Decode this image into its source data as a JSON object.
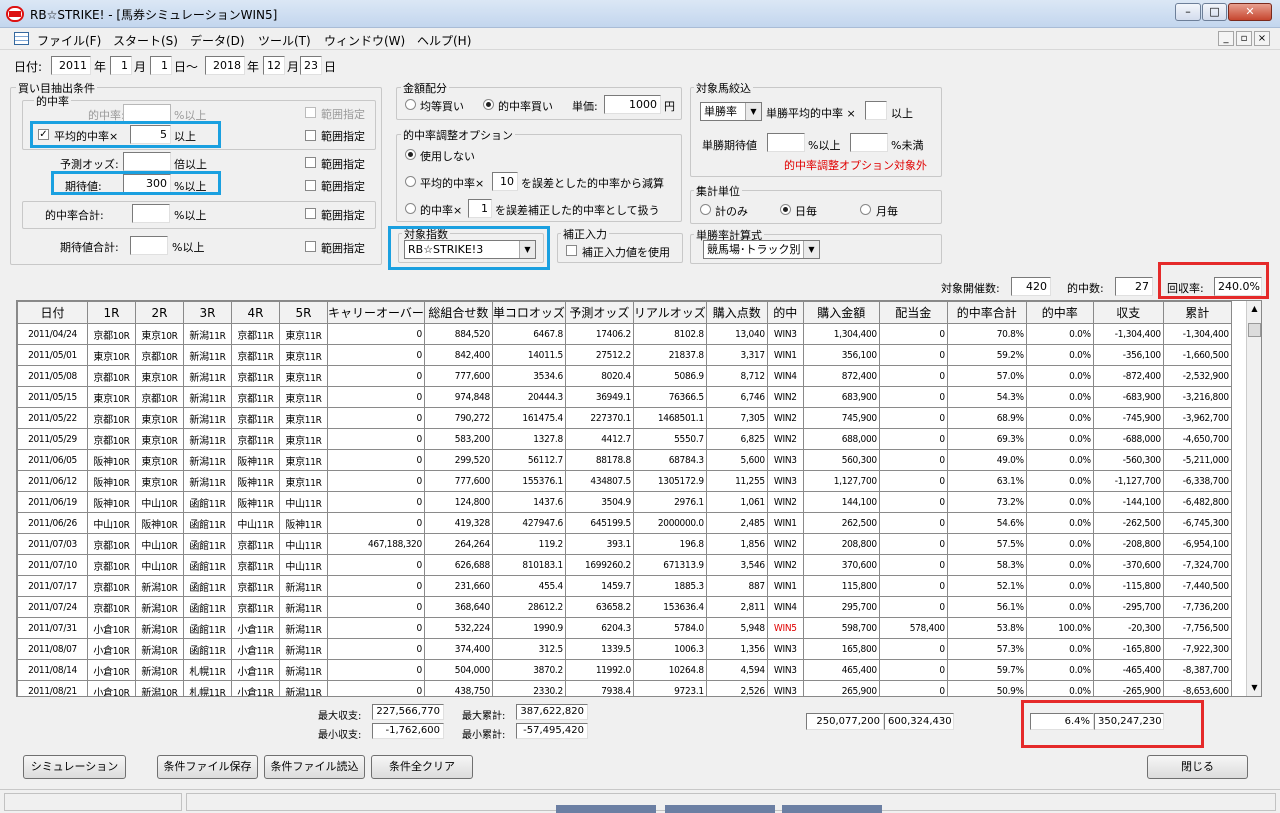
{
  "window": {
    "title": "RB☆STRIKE! - [馬券シミュレーションWIN5]"
  },
  "menu": {
    "items": [
      "ファイル(F)",
      "スタート(S)",
      "データ(D)",
      "ツール(T)",
      "ウィンドウ(W)",
      "ヘルプ(H)"
    ]
  },
  "date": {
    "label": "日付:",
    "start_year": "2011",
    "year_unit": "年",
    "start_month": "1",
    "month_unit": "月",
    "start_day": "1",
    "day_tilde": "日～",
    "end_year": "2018",
    "end_month": "12",
    "end_day": "23",
    "end_day_unit": "日"
  },
  "buy": {
    "group": "買い目抽出条件",
    "sub": "的中率",
    "hit_rate_label": "的中率:",
    "hit_rate_suffix": "%以上",
    "avg_hit_label": "平均的中率×",
    "avg_hit_value": "5",
    "avg_hit_suffix": "以上",
    "pred_odds_label": "予測オッズ:",
    "pred_odds_suffix": "倍以上",
    "ev_label": "期待値:",
    "ev_value": "300",
    "ev_suffix": "%以上",
    "hit_total_label": "的中率合計:",
    "hit_total_suffix": "%以上",
    "ev_total_label": "期待値合計:",
    "ev_total_suffix": "%以上",
    "range_label": "範囲指定"
  },
  "money": {
    "group": "金額配分",
    "equal": "均等買い",
    "hit_buy": "的中率買い",
    "unit_label": "単価:",
    "unit_value": "1000",
    "unit_suffix": "円"
  },
  "adjust": {
    "group": "的中率調整オプション",
    "none": "使用しない",
    "opt1_pre": "平均的中率×",
    "opt1_value": "10",
    "opt1_post": "を誤差とした的中率から減算",
    "opt2_pre": "的中率×",
    "opt2_value": "1",
    "opt2_post": "を誤差補正した的中率として扱う"
  },
  "target_index": {
    "group": "対象指数",
    "value": "RB☆STRIKE!3"
  },
  "correction": {
    "group": "補正入力",
    "label": "補正入力値を使用"
  },
  "horse": {
    "group": "対象馬絞込",
    "sel": "単勝率",
    "avg_label": "単勝平均的中率 ×",
    "avg_suffix": "以上",
    "ev_label": "単勝期待値",
    "ev_mid": "%以上",
    "ev_suffix": "%未満",
    "note": "的中率調整オプション対象外"
  },
  "unit": {
    "group": "集計単位",
    "total": "計のみ",
    "daily": "日毎",
    "monthly": "月毎"
  },
  "calc": {
    "group": "単勝率計算式",
    "value": "競馬場･トラック別"
  },
  "summary": {
    "events_label": "対象開催数:",
    "events_value": "420",
    "hits_label": "的中数:",
    "hits_value": "27",
    "return_label": "回収率:",
    "return_value": "240.0%"
  },
  "table": {
    "headers": [
      "日付",
      "1R",
      "2R",
      "3R",
      "4R",
      "5R",
      "キャリーオーバー",
      "総組合せ数",
      "単コロオッズ",
      "予測オッズ",
      "リアルオッズ",
      "購入点数",
      "的中",
      "購入金額",
      "配当金",
      "的中率合計",
      "的中率",
      "収支",
      "累計"
    ],
    "rows": [
      [
        "2011/04/24",
        "京都10R",
        "東京10R",
        "新潟11R",
        "京都11R",
        "東京11R",
        "0",
        "884,520",
        "6467.8",
        "17406.2",
        "8102.8",
        "13,040",
        "WIN3",
        "1,304,400",
        "0",
        "70.8%",
        "0.0%",
        "-1,304,400",
        "-1,304,400"
      ],
      [
        "2011/05/01",
        "東京10R",
        "京都10R",
        "新潟11R",
        "京都11R",
        "東京11R",
        "0",
        "842,400",
        "14011.5",
        "27512.2",
        "21837.8",
        "3,317",
        "WIN1",
        "356,100",
        "0",
        "59.2%",
        "0.0%",
        "-356,100",
        "-1,660,500"
      ],
      [
        "2011/05/08",
        "京都10R",
        "東京10R",
        "新潟11R",
        "京都11R",
        "東京11R",
        "0",
        "777,600",
        "3534.6",
        "8020.4",
        "5086.9",
        "8,712",
        "WIN4",
        "872,400",
        "0",
        "57.0%",
        "0.0%",
        "-872,400",
        "-2,532,900"
      ],
      [
        "2011/05/15",
        "東京10R",
        "京都10R",
        "新潟11R",
        "京都11R",
        "東京11R",
        "0",
        "974,848",
        "20444.3",
        "36949.1",
        "76366.5",
        "6,746",
        "WIN2",
        "683,900",
        "0",
        "54.3%",
        "0.0%",
        "-683,900",
        "-3,216,800"
      ],
      [
        "2011/05/22",
        "京都10R",
        "東京10R",
        "新潟11R",
        "京都11R",
        "東京11R",
        "0",
        "790,272",
        "161475.4",
        "227370.1",
        "1468501.1",
        "7,305",
        "WIN2",
        "745,900",
        "0",
        "68.9%",
        "0.0%",
        "-745,900",
        "-3,962,700"
      ],
      [
        "2011/05/29",
        "京都10R",
        "東京10R",
        "新潟11R",
        "京都11R",
        "東京11R",
        "0",
        "583,200",
        "1327.8",
        "4412.7",
        "5550.7",
        "6,825",
        "WIN2",
        "688,000",
        "0",
        "69.3%",
        "0.0%",
        "-688,000",
        "-4,650,700"
      ],
      [
        "2011/06/05",
        "阪神10R",
        "東京10R",
        "新潟11R",
        "阪神11R",
        "東京11R",
        "0",
        "299,520",
        "56112.7",
        "88178.8",
        "68784.3",
        "5,600",
        "WIN3",
        "560,300",
        "0",
        "49.0%",
        "0.0%",
        "-560,300",
        "-5,211,000"
      ],
      [
        "2011/06/12",
        "阪神10R",
        "東京10R",
        "新潟11R",
        "阪神11R",
        "東京11R",
        "0",
        "777,600",
        "155376.1",
        "434807.5",
        "1305172.9",
        "11,255",
        "WIN3",
        "1,127,700",
        "0",
        "63.1%",
        "0.0%",
        "-1,127,700",
        "-6,338,700"
      ],
      [
        "2011/06/19",
        "阪神10R",
        "中山10R",
        "函館11R",
        "阪神11R",
        "中山11R",
        "0",
        "124,800",
        "1437.6",
        "3504.9",
        "2976.1",
        "1,061",
        "WIN2",
        "144,100",
        "0",
        "73.2%",
        "0.0%",
        "-144,100",
        "-6,482,800"
      ],
      [
        "2011/06/26",
        "中山10R",
        "阪神10R",
        "函館11R",
        "中山11R",
        "阪神11R",
        "0",
        "419,328",
        "427947.6",
        "645199.5",
        "2000000.0",
        "2,485",
        "WIN1",
        "262,500",
        "0",
        "54.6%",
        "0.0%",
        "-262,500",
        "-6,745,300"
      ],
      [
        "2011/07/03",
        "京都10R",
        "中山10R",
        "函館11R",
        "京都11R",
        "中山11R",
        "467,188,320",
        "264,264",
        "119.2",
        "393.1",
        "196.8",
        "1,856",
        "WIN2",
        "208,800",
        "0",
        "57.5%",
        "0.0%",
        "-208,800",
        "-6,954,100"
      ],
      [
        "2011/07/10",
        "京都10R",
        "中山10R",
        "函館11R",
        "京都11R",
        "中山11R",
        "0",
        "626,688",
        "810183.1",
        "1699260.2",
        "671313.9",
        "3,546",
        "WIN2",
        "370,600",
        "0",
        "58.3%",
        "0.0%",
        "-370,600",
        "-7,324,700"
      ],
      [
        "2011/07/17",
        "京都10R",
        "新潟10R",
        "函館11R",
        "京都11R",
        "新潟11R",
        "0",
        "231,660",
        "455.4",
        "1459.7",
        "1885.3",
        "887",
        "WIN1",
        "115,800",
        "0",
        "52.1%",
        "0.0%",
        "-115,800",
        "-7,440,500"
      ],
      [
        "2011/07/24",
        "京都10R",
        "新潟10R",
        "函館11R",
        "京都11R",
        "新潟11R",
        "0",
        "368,640",
        "28612.2",
        "63658.2",
        "153636.4",
        "2,811",
        "WIN4",
        "295,700",
        "0",
        "56.1%",
        "0.0%",
        "-295,700",
        "-7,736,200"
      ],
      [
        "2011/07/31",
        "小倉10R",
        "新潟10R",
        "函館11R",
        "小倉11R",
        "新潟11R",
        "0",
        "532,224",
        "1990.9",
        "6204.3",
        "5784.0",
        "5,948",
        "WIN5",
        "598,700",
        "578,400",
        "53.8%",
        "100.0%",
        "-20,300",
        "-7,756,500"
      ],
      [
        "2011/08/07",
        "小倉10R",
        "新潟10R",
        "函館11R",
        "小倉11R",
        "新潟11R",
        "0",
        "374,400",
        "312.5",
        "1339.5",
        "1006.3",
        "1,356",
        "WIN3",
        "165,800",
        "0",
        "57.3%",
        "0.0%",
        "-165,800",
        "-7,922,300"
      ],
      [
        "2011/08/14",
        "小倉10R",
        "新潟10R",
        "札幌11R",
        "小倉11R",
        "新潟11R",
        "0",
        "504,000",
        "3870.2",
        "11992.0",
        "10264.8",
        "4,594",
        "WIN3",
        "465,400",
        "0",
        "59.7%",
        "0.0%",
        "-465,400",
        "-8,387,700"
      ],
      [
        "2011/08/21",
        "小倉10R",
        "新潟10R",
        "札幌11R",
        "小倉11R",
        "新潟11R",
        "0",
        "438,750",
        "2330.2",
        "7938.4",
        "9723.1",
        "2,526",
        "WIN3",
        "265,900",
        "0",
        "50.9%",
        "0.0%",
        "-265,900",
        "-8,653,600"
      ]
    ]
  },
  "stats": {
    "max_income_label": "最大収支:",
    "max_income": "227,566,770",
    "min_income_label": "最小収支:",
    "min_income": "-1,762,600",
    "max_cum_label": "最大累計:",
    "max_cum": "387,622,820",
    "min_cum_label": "最小累計:",
    "min_cum": "-57,495,420",
    "total_buy": "250,077,200",
    "total_payout": "600,324,430",
    "hit_rate": "6.4%",
    "total_income": "350,247,230"
  },
  "buttons": {
    "simulate": "シミュレーション",
    "save": "条件ファイル保存",
    "load": "条件ファイル読込",
    "clear": "条件全クリア",
    "close": "閉じる"
  },
  "colors": {
    "highlight_blue": "#1aa0e0",
    "highlight_red": "#e52a2a",
    "win5_red": "#e00000"
  }
}
